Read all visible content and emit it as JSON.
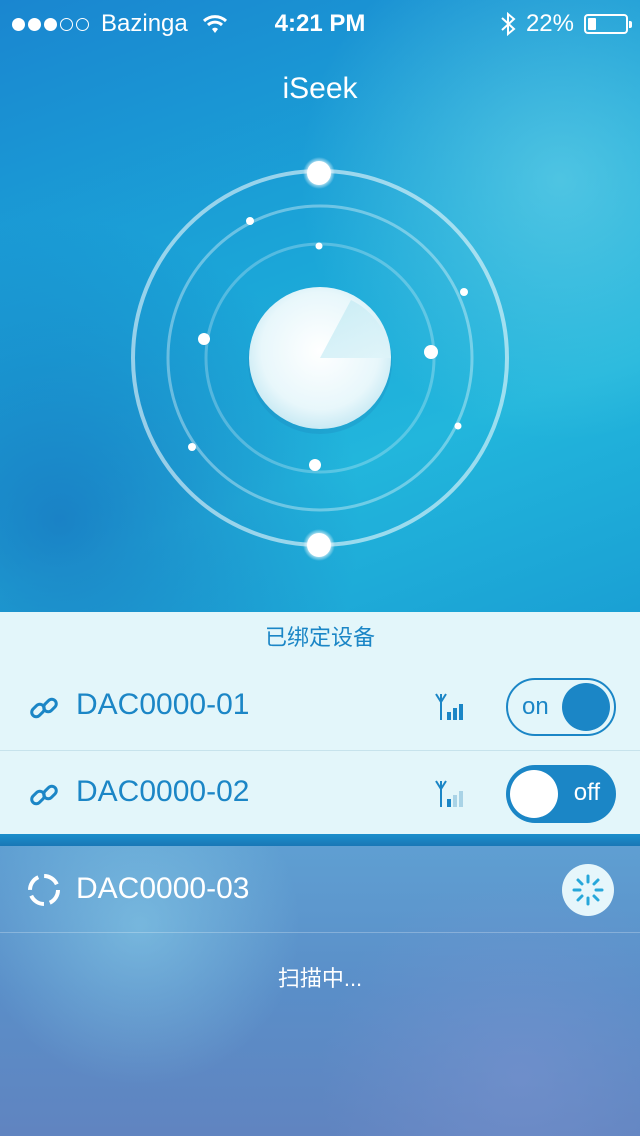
{
  "status_bar": {
    "signal_dots_filled": 3,
    "signal_dots_total": 5,
    "carrier": "Bazinga",
    "time": "4:21 PM",
    "battery_text": "22%",
    "battery_level": 0.22,
    "icons": [
      "wifi-icon",
      "bluetooth-icon",
      "battery-icon"
    ]
  },
  "header": {
    "title": "iSeek"
  },
  "radar": {
    "icons": [
      "radar-icon"
    ]
  },
  "bound_devices": {
    "title": "已绑定设备",
    "items": [
      {
        "name": "DAC0000-01",
        "signal_bars_active": 3,
        "toggle_label": "on",
        "toggle_state": "on"
      },
      {
        "name": "DAC0000-02",
        "signal_bars_active": 1,
        "toggle_label": "off",
        "toggle_state": "off"
      }
    ]
  },
  "scanning": {
    "device_name": "DAC0000-03",
    "status_text": "扫描中..."
  },
  "colors": {
    "accent": "#1b86c6",
    "bound_bg": "#e3f6fa",
    "hero_blue": "#1ba7d8"
  }
}
